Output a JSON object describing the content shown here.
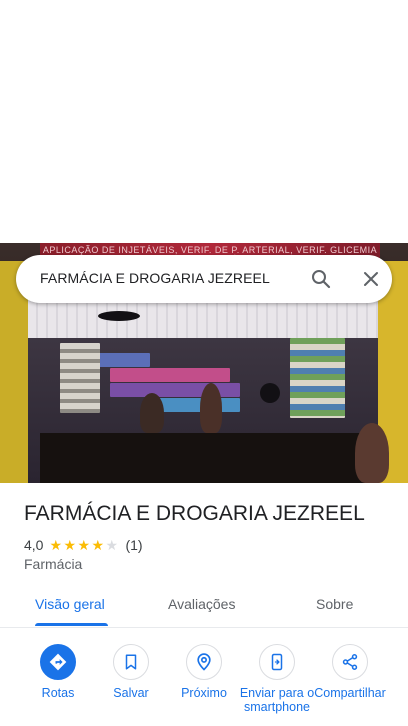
{
  "search": {
    "query": "FARMÁCIA E DROGARIA JEZREEL"
  },
  "hero": {
    "banner_text": "APLICAÇÃO DE INJETÁVEIS, VERIF. DE P. ARTERIAL, VERIF. GLICEMIA  COM MAIS SAÚDE!"
  },
  "place": {
    "title": "FARMÁCIA E DROGARIA JEZREEL",
    "rating": "4,0",
    "stars_filled": 4,
    "stars_total": 5,
    "review_count": "(1)",
    "category": "Farmácia"
  },
  "tabs": [
    {
      "label": "Visão geral",
      "active": true
    },
    {
      "label": "Avaliações",
      "active": false
    },
    {
      "label": "Sobre",
      "active": false
    }
  ],
  "actions": [
    {
      "label": "Rotas",
      "icon": "directions-icon"
    },
    {
      "label": "Salvar",
      "icon": "bookmark-icon"
    },
    {
      "label": "Próximo",
      "icon": "nearby-icon"
    },
    {
      "label": "Enviar para o smartphone",
      "icon": "send-to-phone-icon"
    },
    {
      "label": "Compartilhar",
      "icon": "share-icon"
    }
  ],
  "colors": {
    "accent": "#1a73e8",
    "star": "#fbbc04",
    "star_empty": "#dadce0",
    "text_primary": "#202124",
    "text_secondary": "#5f6368"
  }
}
